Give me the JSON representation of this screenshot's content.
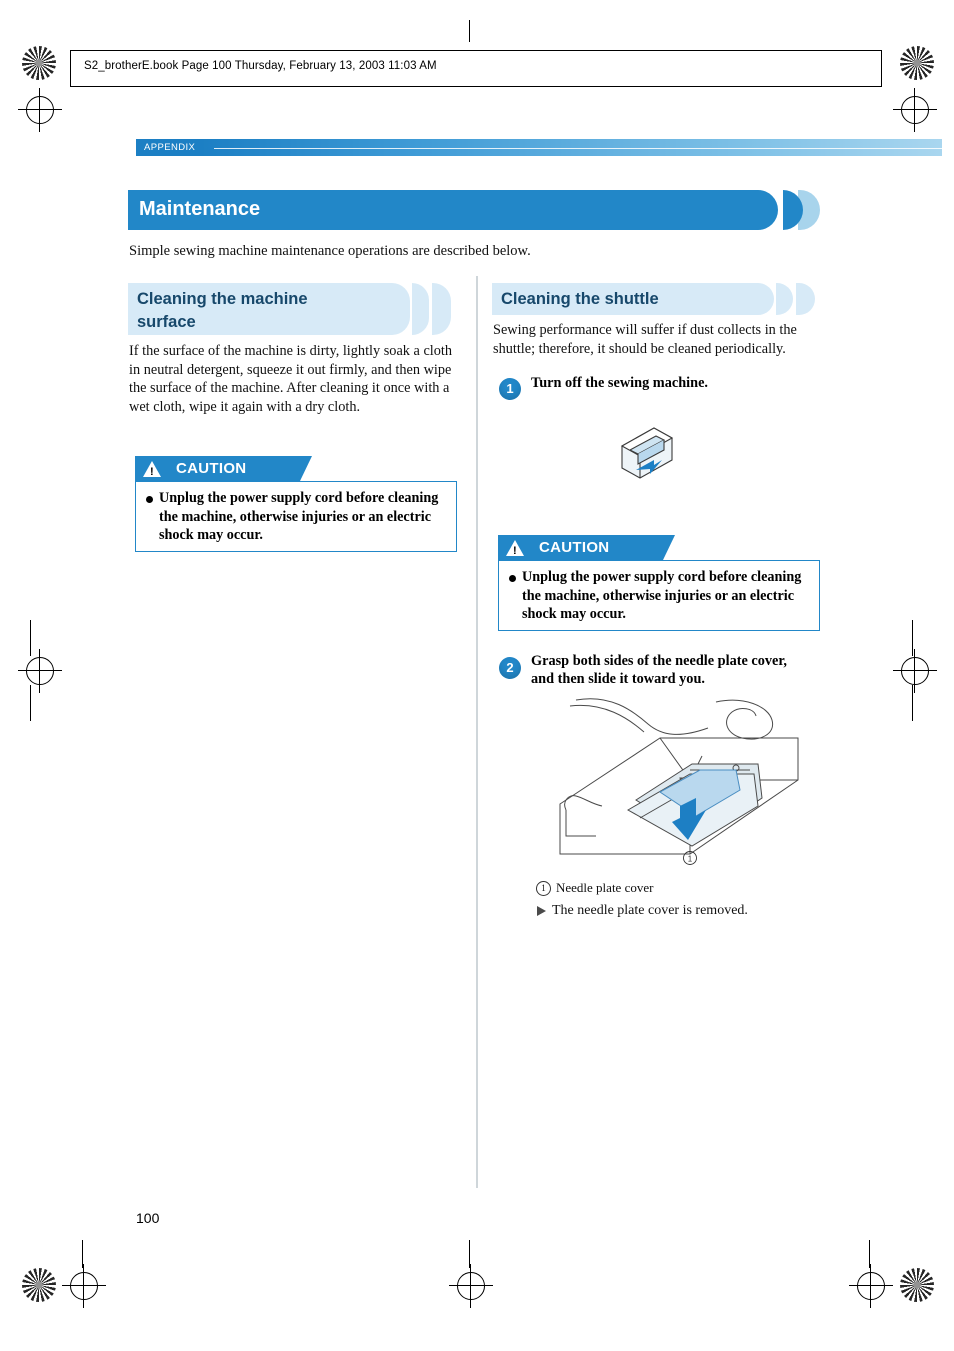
{
  "header": {
    "file_line": "S2_brotherE.book  Page 100  Thursday, February 13, 2003  11:03 AM",
    "section_label": "APPENDIX"
  },
  "title": "Maintenance",
  "intro": "Simple sewing machine maintenance operations are described below.",
  "left_column": {
    "section_title_line1": "Cleaning the machine",
    "section_title_line2": "surface",
    "body": "If the surface of the machine is dirty, lightly soak a cloth in neutral detergent, squeeze it out firmly, and then wipe the surface of the machine. After cleaning it once with a wet cloth, wipe it again with a dry cloth.",
    "caution": {
      "label": "CAUTION",
      "text": "Unplug the power supply cord before cleaning the machine, otherwise injuries or an electric shock may occur."
    }
  },
  "right_column": {
    "section_title": "Cleaning the shuttle",
    "body": "Sewing performance will suffer if dust collects in the shuttle; therefore, it should be cleaned periodically.",
    "step1": {
      "number": "1",
      "text": "Turn off the sewing machine."
    },
    "caution": {
      "label": "CAUTION",
      "text": "Unplug the power supply cord before cleaning the machine, otherwise injuries or an electric shock may occur."
    },
    "step2": {
      "number": "2",
      "text_line1": "Grasp both sides of the needle plate cover,",
      "text_line2": "and then slide it toward you."
    },
    "figure_callout": "1",
    "caption": "Needle plate cover",
    "result": "The needle plate cover is removed."
  },
  "page_number": "100",
  "colors": {
    "accent": "#2287c8",
    "section_bg": "#d7eaf7",
    "band_start": "#1c7fc4",
    "band_end": "#a9d6ef"
  }
}
